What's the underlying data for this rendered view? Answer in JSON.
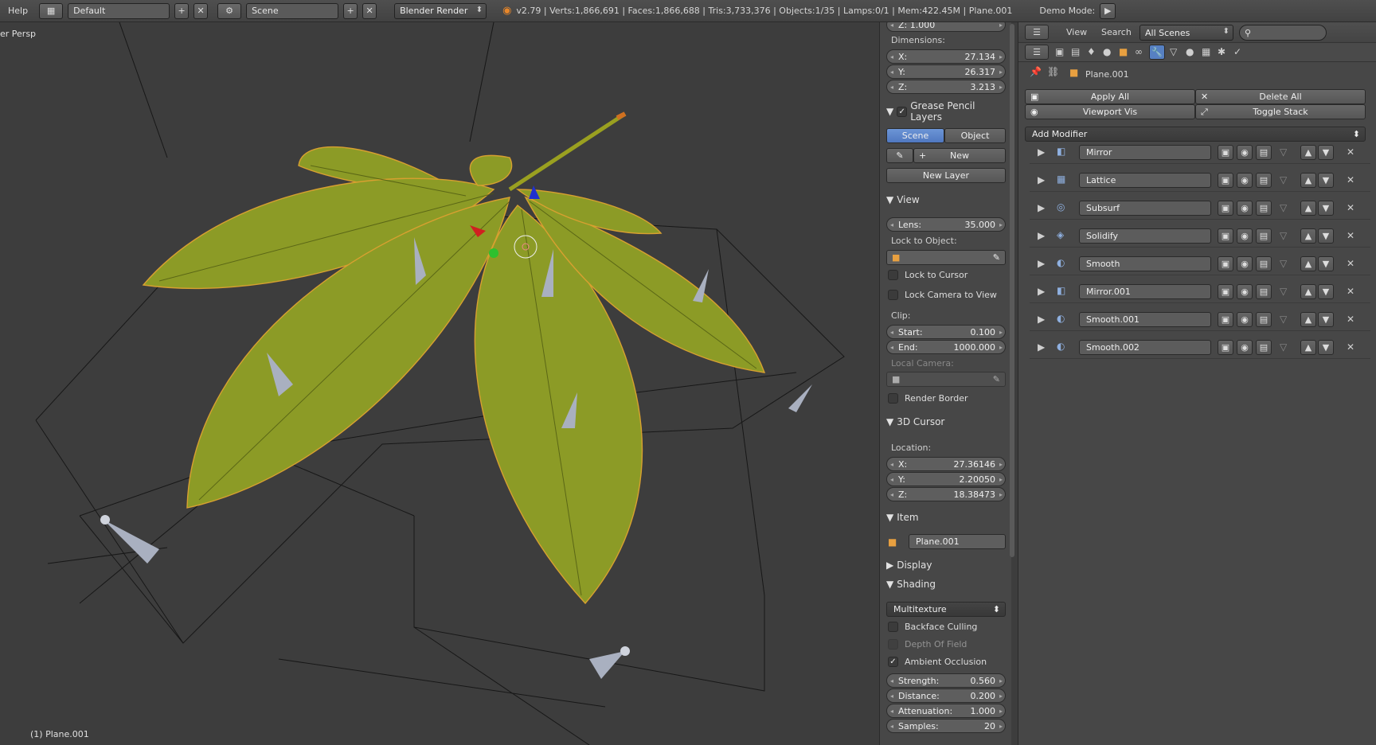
{
  "topbar": {
    "help": "Help",
    "layout": "Default",
    "scene": "Scene",
    "engine": "Blender Render",
    "stats": "v2.79 | Verts:1,866,691 | Faces:1,866,688 | Tris:3,733,376 | Objects:1/35 | Lamps:0/1 | Mem:422.45M | Plane.001",
    "demo_mode": "Demo Mode:"
  },
  "viewport": {
    "view_name": "er Persp",
    "object_label": "(1) Plane.001"
  },
  "props": {
    "dim_z_top": "Z: 1.000",
    "dimensions_label": "Dimensions:",
    "dimensions": [
      {
        "axis": "X:",
        "value": "27.134"
      },
      {
        "axis": "Y:",
        "value": "26.317"
      },
      {
        "axis": "Z:",
        "value": "3.213"
      }
    ],
    "grease_pencil": {
      "title": "Grease Pencil Layers",
      "scene": "Scene",
      "object": "Object",
      "new": "New",
      "new_layer": "New Layer"
    },
    "view": {
      "title": "View",
      "lens_label": "Lens:",
      "lens_value": "35.000",
      "lock_to_object": "Lock to Object:",
      "lock_to_cursor": "Lock to Cursor",
      "lock_camera": "Lock Camera to View",
      "clip_label": "Clip:",
      "clip_start_label": "Start:",
      "clip_start": "0.100",
      "clip_end_label": "End:",
      "clip_end": "1000.000",
      "local_camera": "Local Camera:",
      "render_border": "Render Border"
    },
    "cursor": {
      "title": "3D Cursor",
      "location": "Location:",
      "coords": [
        {
          "axis": "X:",
          "value": "27.36146"
        },
        {
          "axis": "Y:",
          "value": "2.20050"
        },
        {
          "axis": "Z:",
          "value": "18.38473"
        }
      ]
    },
    "item": {
      "title": "Item",
      "name": "Plane.001"
    },
    "display": {
      "title": "Display"
    },
    "shading": {
      "title": "Shading",
      "mode": "Multitexture",
      "backface": "Backface Culling",
      "dof": "Depth Of Field",
      "ao": "Ambient Occlusion",
      "params": [
        {
          "label": "Strength:",
          "value": "0.560"
        },
        {
          "label": "Distance:",
          "value": "0.200"
        },
        {
          "label": "Attenuation:",
          "value": "1.000"
        },
        {
          "label": "Samples:",
          "value": "20"
        }
      ]
    }
  },
  "modifiers": {
    "header_view": "View",
    "header_search": "Search",
    "scenes": "All Scenes",
    "object_name": "Plane.001",
    "apply_all": "Apply All",
    "delete_all": "Delete All",
    "viewport_vis": "Viewport Vis",
    "toggle_stack": "Toggle Stack",
    "add_modifier": "Add Modifier",
    "list": [
      {
        "name": "Mirror",
        "icon": "mirror-icon"
      },
      {
        "name": "Lattice",
        "icon": "lattice-icon"
      },
      {
        "name": "Subsurf",
        "icon": "subsurf-icon"
      },
      {
        "name": "Solidify",
        "icon": "solidify-icon"
      },
      {
        "name": "Smooth",
        "icon": "smooth-icon"
      },
      {
        "name": "Mirror.001",
        "icon": "mirror-icon"
      },
      {
        "name": "Smooth.001",
        "icon": "smooth-icon"
      },
      {
        "name": "Smooth.002",
        "icon": "smooth-icon"
      }
    ]
  },
  "colors": {
    "leaf": "#8a9a2a",
    "accent": "#5680c2",
    "selection": "#e8a020"
  }
}
